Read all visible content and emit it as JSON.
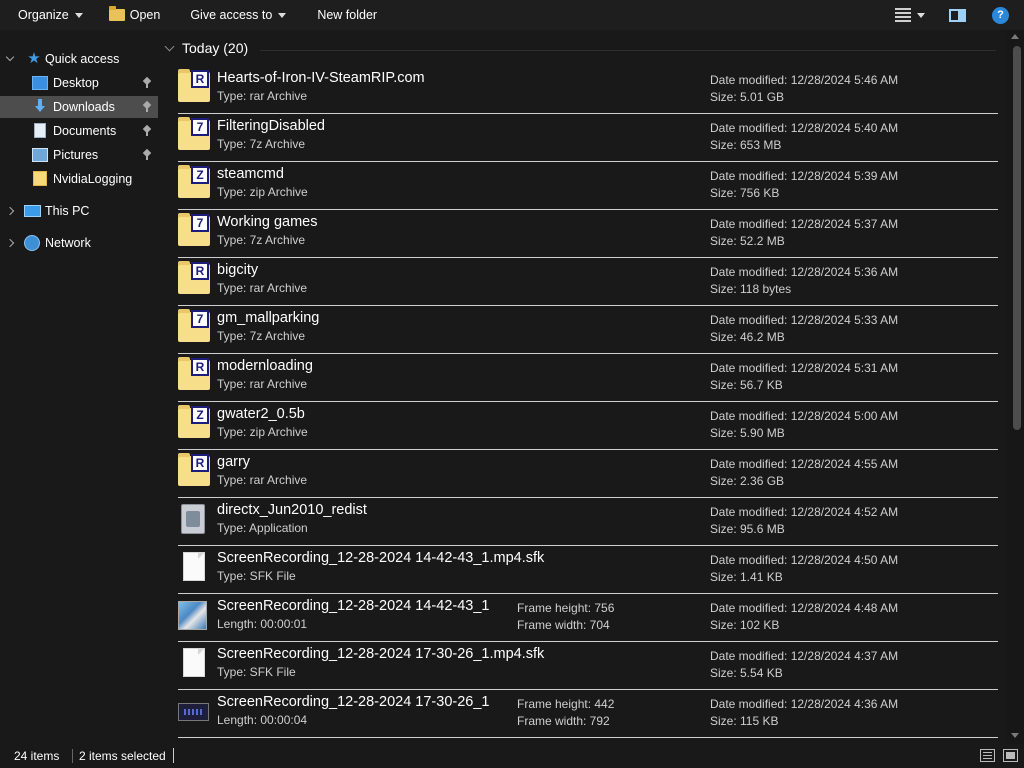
{
  "toolbar": {
    "organize": "Organize",
    "open": "Open",
    "give_access": "Give access to",
    "new_folder": "New folder",
    "help": "?"
  },
  "sidebar": {
    "quick_access": "Quick access",
    "items": [
      {
        "label": "Desktop",
        "icon": "desktop-icon",
        "pinned": true
      },
      {
        "label": "Downloads",
        "icon": "downloads-icon",
        "pinned": true,
        "selected": true
      },
      {
        "label": "Documents",
        "icon": "documents-icon",
        "pinned": true
      },
      {
        "label": "Pictures",
        "icon": "pictures-icon",
        "pinned": true
      },
      {
        "label": "NvidiaLogging",
        "icon": "folder-icon",
        "pinned": false
      }
    ],
    "this_pc": "This PC",
    "network": "Network"
  },
  "group": {
    "header": "Today (20)"
  },
  "files": [
    {
      "name": "Hearts-of-Iron-IV-SteamRIP.com",
      "sub": "Type: rar Archive",
      "date": "Date modified:  12/28/2024 5:46 AM",
      "size": "Size:  5.01 GB",
      "icon": "rar-archive-icon",
      "badge": "R"
    },
    {
      "name": "FilteringDisabled",
      "sub": "Type: 7z Archive",
      "date": "Date modified:  12/28/2024 5:40 AM",
      "size": "Size:  653 MB",
      "icon": "7z-archive-icon",
      "badge": "7"
    },
    {
      "name": "steamcmd",
      "sub": "Type: zip Archive",
      "date": "Date modified:  12/28/2024 5:39 AM",
      "size": "Size:  756 KB",
      "icon": "zip-archive-icon",
      "badge": "Z"
    },
    {
      "name": "Working games",
      "sub": "Type: 7z Archive",
      "date": "Date modified:  12/28/2024 5:37 AM",
      "size": "Size:  52.2 MB",
      "icon": "7z-archive-icon",
      "badge": "7"
    },
    {
      "name": "bigcity",
      "sub": "Type: rar Archive",
      "date": "Date modified:  12/28/2024 5:36 AM",
      "size": "Size:  118 bytes",
      "icon": "rar-archive-icon",
      "badge": "R"
    },
    {
      "name": "gm_mallparking",
      "sub": "Type: 7z Archive",
      "date": "Date modified:  12/28/2024 5:33 AM",
      "size": "Size:  46.2 MB",
      "icon": "7z-archive-icon",
      "badge": "7"
    },
    {
      "name": "modernloading",
      "sub": "Type: rar Archive",
      "date": "Date modified:  12/28/2024 5:31 AM",
      "size": "Size:  56.7 KB",
      "icon": "rar-archive-icon",
      "badge": "R"
    },
    {
      "name": "gwater2_0.5b",
      "sub": "Type: zip Archive",
      "date": "Date modified:  12/28/2024 5:00 AM",
      "size": "Size:  5.90 MB",
      "icon": "zip-archive-icon",
      "badge": "Z"
    },
    {
      "name": "garry",
      "sub": "Type: rar Archive",
      "date": "Date modified:  12/28/2024 4:55 AM",
      "size": "Size:  2.36 GB",
      "icon": "rar-archive-icon",
      "badge": "R"
    },
    {
      "name": "directx_Jun2010_redist",
      "sub": "Type: Application",
      "date": "Date modified:  12/28/2024 4:52 AM",
      "size": "Size:  95.6 MB",
      "icon": "application-icon"
    },
    {
      "name": "ScreenRecording_12-28-2024 14-42-43_1.mp4.sfk",
      "sub": "Type: SFK File",
      "date": "Date modified:  12/28/2024 4:50 AM",
      "size": "Size:  1.41 KB",
      "icon": "sfk-file-icon"
    },
    {
      "name": "ScreenRecording_12-28-2024 14-42-43_1",
      "sub": "Length: 00:00:01",
      "mid1": "Frame height: 756",
      "mid2": "Frame width: 704",
      "date": "Date modified:  12/28/2024 4:48 AM",
      "size": "Size:  102 KB",
      "icon": "video-thumbnail-icon"
    },
    {
      "name": "ScreenRecording_12-28-2024 17-30-26_1.mp4.sfk",
      "sub": "Type: SFK File",
      "date": "Date modified:  12/28/2024 4:37 AM",
      "size": "Size:  5.54 KB",
      "icon": "sfk-file-icon"
    },
    {
      "name": "ScreenRecording_12-28-2024 17-30-26_1",
      "sub": "Length: 00:00:04",
      "mid1": "Frame height: 442",
      "mid2": "Frame width: 792",
      "date": "Date modified:  12/28/2024 4:36 AM",
      "size": "Size:  115 KB",
      "icon": "video-thumbnail-icon"
    }
  ],
  "status": {
    "count": "24 items",
    "selected": "2 items selected"
  },
  "colors": {
    "background": "#191919",
    "selected_nav": "#4d4d4d",
    "accent": "#2b88d8"
  }
}
